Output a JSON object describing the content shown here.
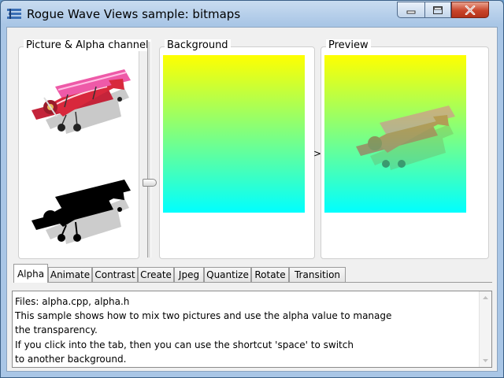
{
  "window": {
    "title": "Rogue Wave Views sample: bitmaps",
    "controls": [
      "minimize-icon",
      "maximize-icon",
      "close-icon"
    ]
  },
  "panels": {
    "picture": {
      "label": "Picture & Alpha channel"
    },
    "background": {
      "label": "Background",
      "gradient": [
        "#ffff00",
        "#00ffff"
      ]
    },
    "preview": {
      "label": "Preview"
    },
    "arrow": ">"
  },
  "tabs": [
    {
      "label": "Alpha",
      "active": true
    },
    {
      "label": "Animate"
    },
    {
      "label": "Contrast"
    },
    {
      "label": "Create"
    },
    {
      "label": "Jpeg"
    },
    {
      "label": "Quantize"
    },
    {
      "label": "Rotate"
    },
    {
      "label": "Transition"
    }
  ],
  "description": {
    "lines": [
      "Files: alpha.cpp, alpha.h",
      "This sample shows how to mix two pictures and use the alpha value to manage",
      "the transparency.",
      "If you click into the tab, then you can use the shortcut 'space' to switch",
      "to another background."
    ]
  },
  "colors": {
    "close_button": "#c9452a",
    "titlebar": "#a9c6e6"
  }
}
